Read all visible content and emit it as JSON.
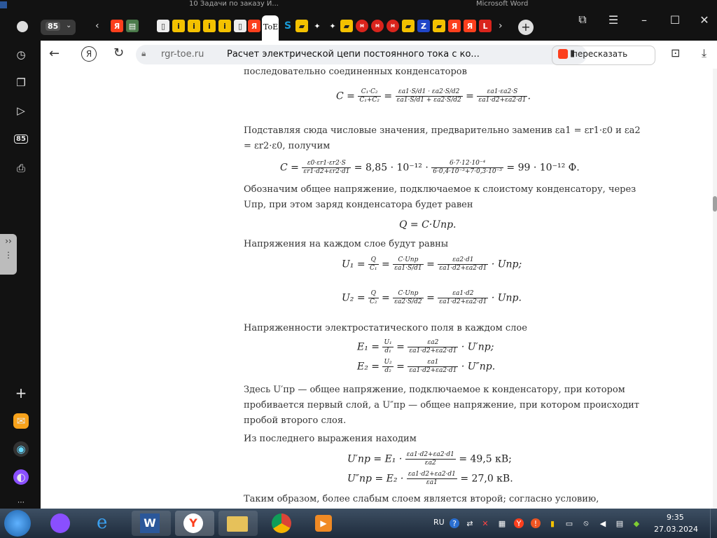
{
  "browser": {
    "tab_counter": "85",
    "active_tab_label": "ToE",
    "window_title_fragment_1": "10 Задачи по заказу И...",
    "window_title_fragment_2": "Microsoft Word",
    "url_domain": "rgr-toe.ru",
    "page_title": "Расчет электрической цепи постоянного тока с ко...",
    "retell_label": "пересказать",
    "sidebar_badge": "85"
  },
  "article": {
    "line_intro": "последовательно соединенных конденсаторов",
    "eq1_lhs": "C",
    "eq1_f1_num": "C₁·C₂",
    "eq1_f1_den": "C₁+C₂",
    "eq1_f2_num": "εa1·S/d1 · εa2·S/d2",
    "eq1_f2_den": "εa1·S/d1 + εa2·S/d2",
    "eq1_f3_num": "εa1·εa2·S",
    "eq1_f3_den": "εa1·d2+εa2·d1",
    "para1_line1": "Подставляя сюда числовые значения, предварительно заменив εa1 = εr1·ε0 и εa2",
    "para1_line2": "= εr2·ε0, получим",
    "eq2_lhs": "C",
    "eq2_f1_num": "ε0·εr1·εr2·S",
    "eq2_f1_den": "εr1·d2+εr2·d1",
    "eq2_mid": "= 8,85 · 10⁻¹² ·",
    "eq2_f2_num": "6·7·12·10⁻⁴",
    "eq2_f2_den": "6·0,4·10⁻³+7·0,3·10⁻³",
    "eq2_result": "= 99 · 10⁻¹²  Ф.",
    "para2_line1": "Обозначим общее напряжение, подключаемое к слоистому конденсатору, через",
    "para2_line2": "Uпр, при этом заряд конденсатора будет равен",
    "eq3": "Q = C·Uпр.",
    "para3": "Напряжения на каждом слое будут равны",
    "eq4_lhs": "U₁ =",
    "eq4_f1_num": "Q",
    "eq4_f1_den": "C₁",
    "eq4_f2_num": "C·Uпр",
    "eq4_f2_den": "εa1·S/d1",
    "eq4_f3_num": "εa2·d1",
    "eq4_f3_den": "εa1·d2+εa2·d1",
    "eq4_tail": "· Uпр;",
    "eq5_lhs": "U₂ =",
    "eq5_f1_num": "Q",
    "eq5_f1_den": "C₂",
    "eq5_f2_num": "C·Uпр",
    "eq5_f2_den": "εa2·S/d2",
    "eq5_f3_num": "εa1·d2",
    "eq5_f3_den": "εa1·d2+εa2·d1",
    "eq5_tail": "· Uпр.",
    "para4": "Напряженности электростатического поля в каждом слое",
    "eq6_lhs": "E₁ =",
    "eq6_f1_num": "U₁",
    "eq6_f1_den": "d₁",
    "eq6_f2_num": "εa2",
    "eq6_f2_den": "εa1·d2+εa2·d1",
    "eq6_tail": "· U′пр;",
    "eq7_lhs": "E₂ =",
    "eq7_f1_num": "U₂",
    "eq7_f1_den": "d₂",
    "eq7_f2_num": "εa1",
    "eq7_f2_den": "εa1·d2+εa2·d1",
    "eq7_tail": "· U″пр.",
    "para5_line1": "Здесь U′пр — общее напряжение, подключаемое к конденсатору, при котором",
    "para5_line2": "пробивается первый слой, а U″пр — общее напряжение, при котором происходит",
    "para5_line3": "пробой второго слоя.",
    "para6": "Из последнего выражения находим",
    "eq8_lhs": "U′пр = E₁ ·",
    "eq8_f_num": "εa1·d2+εa2·d1",
    "eq8_f_den": "εa2",
    "eq8_result": "= 49,5  кВ;",
    "eq9_lhs": "U″пр = E₂ ·",
    "eq9_f_num": "εa1·d2+εa2·d1",
    "eq9_f_den": "εa1",
    "eq9_result": "= 27,0  кВ.",
    "para7": "Таким образом, более слабым слоем является второй; согласно условию,"
  },
  "taskbar": {
    "lang": "RU",
    "time": "9:35",
    "date": "27.03.2024"
  },
  "colors": {
    "tab_strip": "#121212",
    "accent_yandex": "#fc3f1d",
    "taskbar": "#2b3a4b"
  }
}
